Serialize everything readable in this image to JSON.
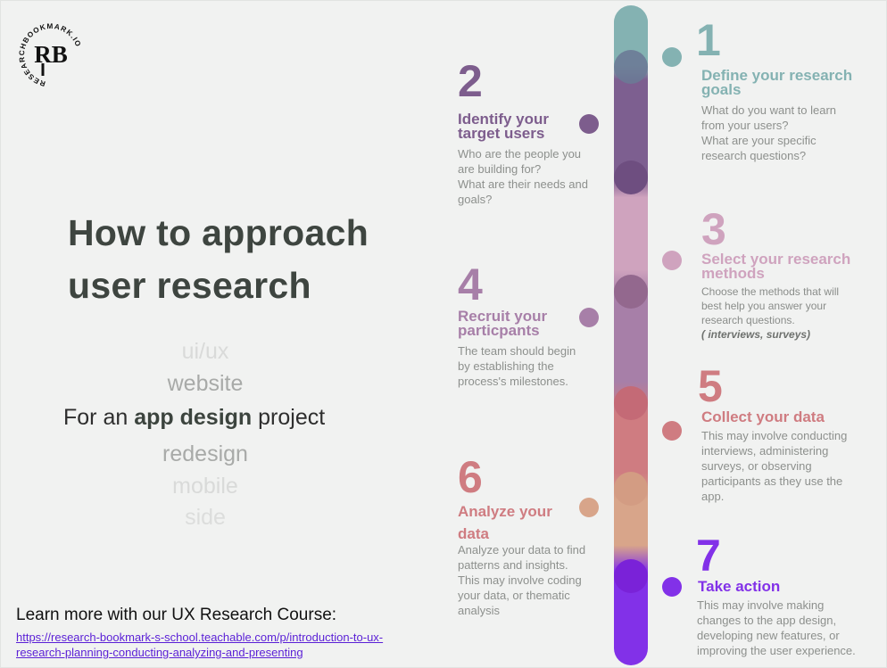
{
  "logo": {
    "monogram": "RB",
    "ring_text": "RESEARCHBOOKMARK.IO"
  },
  "title_line1": "How to approach",
  "title_line2": "user research",
  "project_wheel": {
    "above": [
      "ui/ux",
      "website"
    ],
    "prefix": "For an",
    "selected": "app design",
    "suffix": "project",
    "below": [
      "redesign",
      "mobile",
      "side"
    ]
  },
  "learn_more": "Learn more with our UX Research Course:",
  "course_link": "https://research-bookmark-s-school.teachable.com/p/introduction-to-ux-research-planning-conducting-analyzing-and-presenting",
  "steps": [
    {
      "number": "1",
      "title": "Define your research goals",
      "color": "#84b2b2",
      "lines": [
        "What do you want to learn",
        "from your users?",
        "What are your specific",
        "research questions?"
      ]
    },
    {
      "number": "2",
      "title_lines": [
        "Identify your",
        "target users"
      ],
      "color": "#7d5d8d",
      "lines": [
        "Who are the people you",
        "are building for?",
        "What are their needs and",
        "goals?"
      ]
    },
    {
      "number": "3",
      "title_lines": [
        "Select your research",
        "methods"
      ],
      "color": "#cfa3be",
      "lines": [
        "Choose the methods that will",
        "best help you answer your",
        "research questions."
      ],
      "examples": "( interviews, surveys)"
    },
    {
      "number": "4",
      "title_lines": [
        "Recruit your",
        "particpants"
      ],
      "color": "#a77fa8",
      "lines": [
        "The team should begin",
        "by establishing the",
        "process's milestones."
      ]
    },
    {
      "number": "5",
      "title": "Collect your data",
      "color": "#cf7c81",
      "lines": [
        "This may involve conducting",
        "interviews, administering",
        "surveys, or observing",
        "participants as they use the",
        "app."
      ]
    },
    {
      "number": "6",
      "title_lines": [
        "Analyze your",
        "data"
      ],
      "color": "#d8a58a",
      "lines": [
        "Analyze your data to find",
        "patterns and insights.",
        "This may involve coding",
        "your data, or thematic",
        "analysis"
      ]
    },
    {
      "number": "7",
      "title": "Take action",
      "color": "#8231e8",
      "lines": [
        "This may involve making",
        "changes to the app design,",
        "developing new features, or",
        "improving the user experience."
      ]
    }
  ]
}
